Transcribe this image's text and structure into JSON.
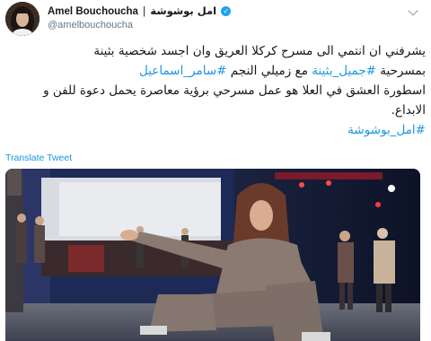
{
  "tweet": {
    "display_name_en": "Amel Bouchoucha",
    "name_separator": "|",
    "display_name_ar": "امل بوشوشة",
    "verified_glyph": "✓",
    "handle": "@amelbouchoucha",
    "text_line1": "يشرفني ان انتمي الى مسرح كركلا العريق وان اجسد شخصية بثينة",
    "text_line2_start": "بمسرحية ",
    "hashtag_1": "#جميل_بثينة",
    "text_line2_mid": " مع زميلي النجم ",
    "hashtag_2": "#سامر_اسماعيل",
    "text_line3": "اسطورة العشق في العلا هو عمل مسرحي برؤية معاصرة يحمل دعوة للفن و",
    "text_line4": "الابداع.",
    "hashtag_3": "#امل_بوشوشة",
    "translate_label": "Translate Tweet",
    "more_icon": "chevron-down-icon"
  },
  "colors": {
    "link": "#1b95e0",
    "text": "#14171a",
    "secondary": "#657786",
    "verified": "#1da1f2"
  }
}
